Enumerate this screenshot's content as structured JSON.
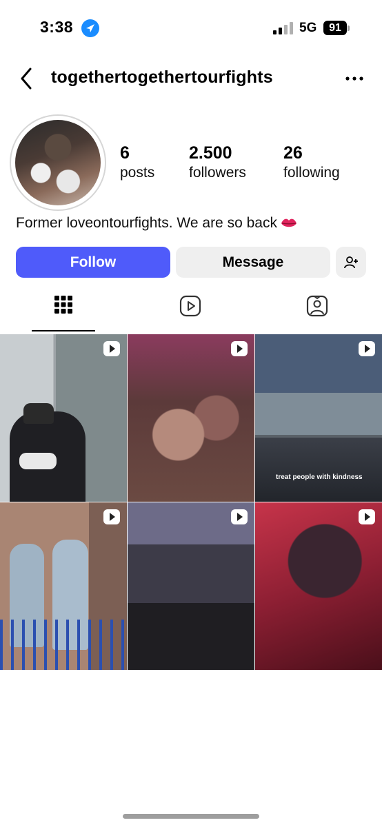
{
  "status_bar": {
    "time": "3:38",
    "network": "5G",
    "battery": "91"
  },
  "header": {
    "username": "togethertogethertourfights"
  },
  "profile": {
    "stats": [
      {
        "value": "6",
        "label": "posts"
      },
      {
        "value": "2.500",
        "label": "followers"
      },
      {
        "value": "26",
        "label": "following"
      }
    ],
    "bio": "Former loveontourfights. We are so back"
  },
  "actions": {
    "follow_label": "Follow",
    "message_label": "Message"
  },
  "tabs": [
    {
      "name": "posts",
      "icon": "grid-icon",
      "active": true
    },
    {
      "name": "reels",
      "icon": "reels-icon",
      "active": false
    },
    {
      "name": "tagged",
      "icon": "tagged-icon",
      "active": false
    }
  ],
  "posts": [
    {
      "type": "reel",
      "caption": ""
    },
    {
      "type": "reel",
      "caption": ""
    },
    {
      "type": "reel",
      "caption": "treat people with kindness"
    },
    {
      "type": "reel",
      "caption": ""
    },
    {
      "type": "reel",
      "caption": ""
    },
    {
      "type": "reel",
      "caption": ""
    }
  ],
  "colors": {
    "follow_button": "#4f5bfa",
    "secondary_button": "#efefef",
    "location_icon": "#1a8cff"
  }
}
